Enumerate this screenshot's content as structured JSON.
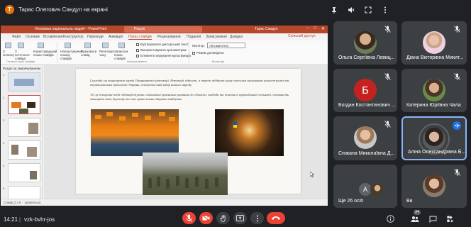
{
  "presenter": {
    "avatar_letter": "Т",
    "label": "Тарас Олегович Сандул на екрані"
  },
  "powerpoint": {
    "title": "Незламна національна людей  –  PowerPoint",
    "search": "Пошук",
    "user": "Тарас Сандул",
    "tabs": [
      "Файл",
      "Основне",
      "Вставлення",
      "Конструктор",
      "Переходи",
      "Анімація",
      "Показ слайдів",
      "Рецензування",
      "Подання",
      "Записування",
      "Довідка"
    ],
    "share": "Спільний доступ",
    "ribbon": {
      "from_start": "З початку",
      "from_current": "З поточного слайда",
      "custom": "Користувацький показ слайдів",
      "setup_show": "Налаштування показу слайдів",
      "hide_slide": "Приховати слайд",
      "rehearse": "Репетиція часу",
      "record": "Записати показ слайдів",
      "play_narrations": "Відтворювати дикторський текст",
      "use_timings": "Використовувати хронометраж",
      "show_controls": "Елементи керування мультимедіа",
      "monitor_label": "Монітор:",
      "monitor_value": "Автоматично",
      "presenter_view": "Режим доповідача",
      "group_start": "Почати показ слайдів",
      "group_setup": "Налаштування",
      "group_monitors": "Монітори"
    },
    "section": "Розділ за замовчуванням",
    "slide_numbers": [
      "1",
      "2",
      "3",
      "4",
      "5",
      "6"
    ],
    "slide_text_1": "Сьогодні ми вшановуємо героїв Помаранчевої революції, Революції гідності, а також віддаємо шану полеглим захисникам незалежності та територіальної цілісності України, оспівуючи їхній вибір нашого народу.",
    "slide_text_2": "Усі ці історичні події підтверджують споконвічні прагнення українців до гідності, свободи та життя в європейській спільноті, готовність захищати свою державу та своє право вільно обирати майбутнє.",
    "status_slide": "Слайд 2 з 9",
    "status_lang": "українська"
  },
  "participants": [
    {
      "name": "Ольга Сергіївна Левиц...",
      "muted": true
    },
    {
      "name": "Діана Вікторівна Микит...",
      "muted": true
    },
    {
      "name": "Богдан Костянтинович ...",
      "letter": "Б",
      "color": "#c5221f",
      "muted": true
    },
    {
      "name": "Катерина Юріївна Чала",
      "muted": true
    },
    {
      "name": "Сніжана Миколаївна Д...",
      "muted": true
    },
    {
      "name": "Аліна Олександрівна Б...",
      "speaking": true
    },
    {
      "name": "Ще 26 осіб",
      "letter": "А",
      "color": "#5f6368"
    },
    {
      "name": "Ви",
      "muted": true
    }
  ],
  "bottom": {
    "time": "14:21",
    "divider": "|",
    "code": "vzk-bvhr-jos",
    "participant_count": "34"
  },
  "colors": {
    "background": "#202124",
    "tile": "#3c4043",
    "danger": "#ea4335",
    "accent": "#8ab4f8",
    "pp_brand": "#b7472a"
  }
}
